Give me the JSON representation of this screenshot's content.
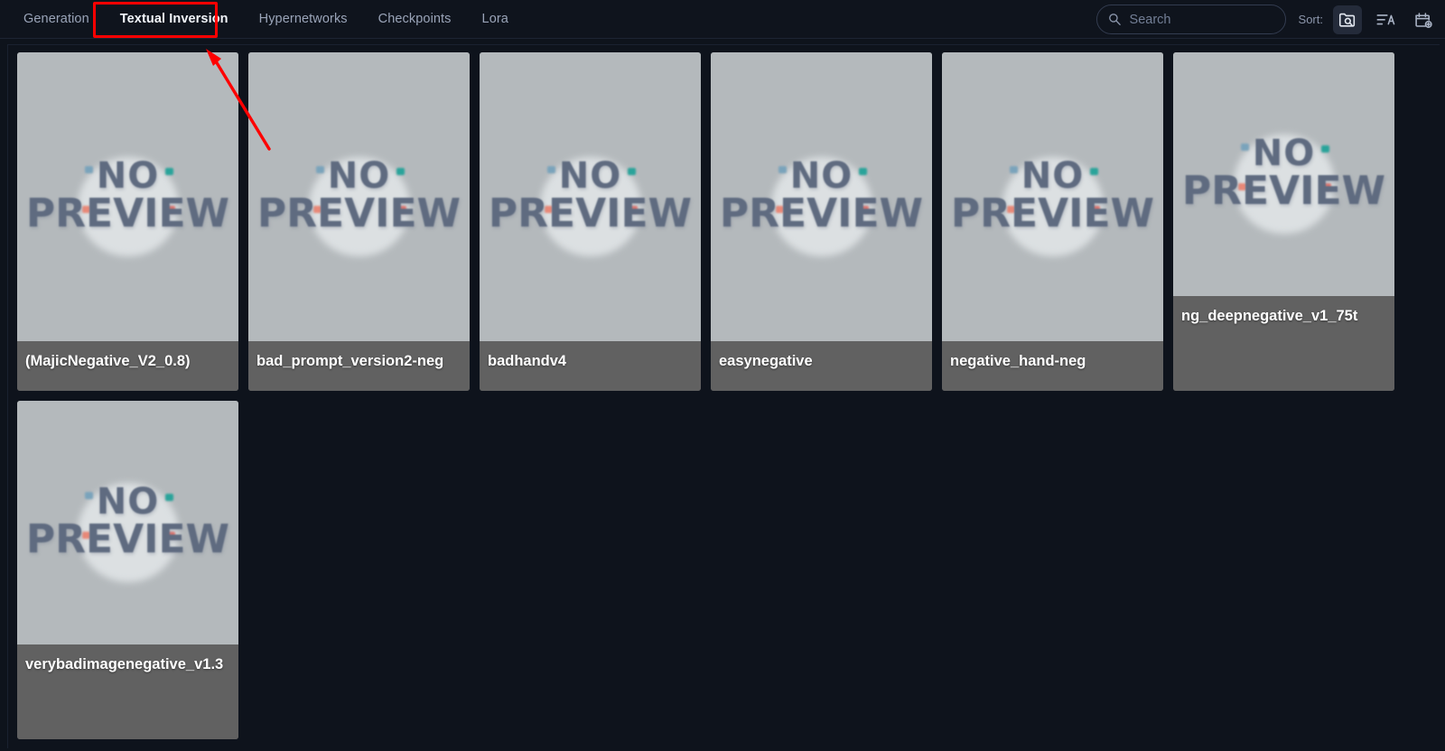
{
  "toolbar": {
    "tabs": [
      {
        "label": "Generation",
        "active": false
      },
      {
        "label": "Textual Inversion",
        "active": true
      },
      {
        "label": "Hypernetworks",
        "active": false
      },
      {
        "label": "Checkpoints",
        "active": false
      },
      {
        "label": "Lora",
        "active": false
      }
    ],
    "search": {
      "placeholder": "Search",
      "value": "",
      "icon": "search-icon"
    },
    "sort": {
      "label": "Sort:",
      "options": [
        {
          "name": "sort-by-path-icon",
          "active": true
        },
        {
          "name": "sort-alphabetical-icon",
          "active": false
        },
        {
          "name": "sort-by-date-icon",
          "active": false
        }
      ]
    }
  },
  "grid": {
    "thumbnail_placeholder": {
      "line1": "NO",
      "line2": "PREVIEW"
    },
    "cards": [
      {
        "label": "(MajicNegative_V2_0.8)"
      },
      {
        "label": "bad_prompt_version2-neg"
      },
      {
        "label": "badhandv4"
      },
      {
        "label": "easynegative"
      },
      {
        "label": "negative_hand-neg"
      },
      {
        "label": "ng_deepnegative_v1_75t"
      },
      {
        "label": "verybadimagenegative_v1.3"
      }
    ]
  },
  "annotations": {
    "highlight_target": "Textual Inversion",
    "highlight_color": "#fe0000"
  }
}
